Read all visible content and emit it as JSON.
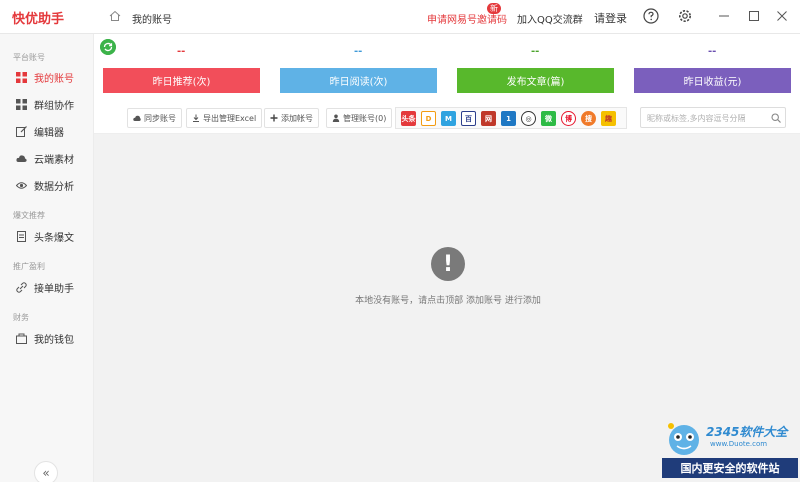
{
  "app": {
    "title": "快优助手"
  },
  "breadcrumb": {
    "current": "我的账号"
  },
  "header": {
    "apply_link": "申请网易号邀请码",
    "new_badge": "新",
    "qq_group": "加入QQ交流群",
    "login": "请登录"
  },
  "sidebar": {
    "groups": [
      {
        "label": "平台账号"
      },
      {
        "label": "爆文推荐"
      },
      {
        "label": "推广盈利"
      },
      {
        "label": "财务"
      }
    ],
    "items": [
      {
        "label": "我的账号",
        "icon": "grid-icon"
      },
      {
        "label": "群组协作",
        "icon": "group-icon"
      },
      {
        "label": "编辑器",
        "icon": "edit-icon"
      },
      {
        "label": "云端素材",
        "icon": "cloud-icon"
      },
      {
        "label": "数据分析",
        "icon": "eye-icon"
      },
      {
        "label": "头条爆文",
        "icon": "document-icon"
      },
      {
        "label": "接单助手",
        "icon": "link-icon"
      },
      {
        "label": "我的钱包",
        "icon": "wallet-icon"
      }
    ],
    "collapse": "«"
  },
  "stats": [
    {
      "value": "--",
      "label": "昨日推荐(次)",
      "color": "#f24e5a",
      "value_color": "#e4393c"
    },
    {
      "value": "--",
      "label": "昨日阅读(次)",
      "color": "#5fb2e6",
      "value_color": "#3f9ad8"
    },
    {
      "value": "--",
      "label": "发布文章(篇)",
      "color": "#58b82c",
      "value_color": "#4aa32a"
    },
    {
      "value": "--",
      "label": "昨日收益(元)",
      "color": "#7b5fbd",
      "value_color": "#6a4fb0"
    }
  ],
  "toolbar": {
    "sync": "同步账号",
    "export": "导出管理Excel",
    "add": "添加帐号",
    "manage": "管理账号(0)"
  },
  "platforms": [
    {
      "label": "头条",
      "color": "#e4393c"
    },
    {
      "label": "D",
      "color": "#f39c12"
    },
    {
      "label": "M",
      "color": "#2fa3e0"
    },
    {
      "label": "百",
      "color": "#2c3e8c"
    },
    {
      "label": "网",
      "color": "#c0392b"
    },
    {
      "label": "1",
      "color": "#1f78c4"
    },
    {
      "label": "◎",
      "color": "#333333"
    },
    {
      "label": "微",
      "color": "#2dbb45"
    },
    {
      "label": "博",
      "color": "#e6162d"
    },
    {
      "label": "搜",
      "color": "#f07a2a"
    },
    {
      "label": "趣",
      "color": "#f5c000"
    }
  ],
  "search": {
    "placeholder": "昵称或标签,多内容逗号分隔"
  },
  "empty": {
    "icon_symbol": "!",
    "message": "本地没有账号，请点击顶部 添加账号 进行添加"
  },
  "watermark": {
    "brand": "2345软件大全",
    "url": "www.Duote.com",
    "banner": "国内更安全的软件站"
  }
}
